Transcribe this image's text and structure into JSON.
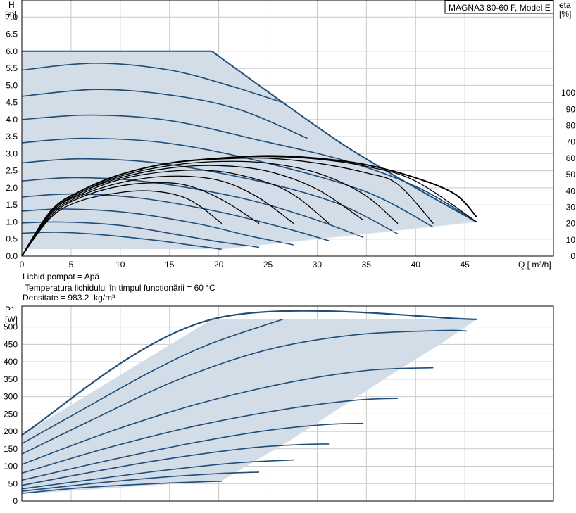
{
  "title": "MAGNA3 80-60 F, Model E",
  "liquid_info": {
    "line1": "Lichid pompat = Apă",
    "line2": " Temperatura lichidului în timpul funcționării = 60 °C",
    "line3": "Densitate = 983.2  kg/m³"
  },
  "colors": {
    "envelope_fill": "#d2dde8",
    "pump_curve": "#1f4e79",
    "envelope_edge": "#1f4e79",
    "efficiency_curve": "#000000"
  },
  "chart_data": [
    {
      "type": "line",
      "name": "head",
      "ylabel_line1": "H",
      "ylabel_line2": "[m]",
      "y2label_line1": "eta",
      "y2label_line2": "[%]",
      "xlabel": "Q [ m³/h]",
      "xlim": [
        0,
        54
      ],
      "ylim": [
        0,
        7.5
      ],
      "y2lim": [
        0,
        157
      ],
      "x_ticks": [
        0,
        5,
        10,
        15,
        20,
        25,
        30,
        35,
        40,
        45
      ],
      "y_ticks": [
        "0.0",
        "0.5",
        "1.0",
        "1.5",
        "2.0",
        "2.5",
        "3.0",
        "3.5",
        "4.0",
        "4.5",
        "5.0",
        "5.5",
        "6.0",
        "6.5",
        "7.0"
      ],
      "y2_ticks": [
        0,
        10,
        20,
        30,
        40,
        50,
        60,
        70,
        80,
        90,
        100
      ],
      "grid": true,
      "envelope": [
        [
          0,
          6.0
        ],
        [
          19.3,
          6.0
        ],
        [
          26.5,
          4.5
        ],
        [
          33,
          3.2
        ],
        [
          40,
          2.0
        ],
        [
          46.2,
          1.0
        ],
        [
          20.3,
          0.2
        ],
        [
          0,
          0.2
        ]
      ],
      "series": [
        {
          "values": [
            [
              0,
              6.0
            ],
            [
              19.3,
              6.0
            ]
          ]
        },
        {
          "values": [
            [
              0,
              5.45
            ],
            [
              7.5,
              5.65
            ],
            [
              15,
              5.45
            ],
            [
              21,
              5.0
            ],
            [
              26.5,
              4.5
            ]
          ]
        },
        {
          "values": [
            [
              0,
              4.68
            ],
            [
              7.5,
              4.88
            ],
            [
              15,
              4.72
            ],
            [
              22,
              4.3
            ],
            [
              29,
              3.45
            ]
          ]
        },
        {
          "values": [
            [
              0,
              4.0
            ],
            [
              7,
              4.13
            ],
            [
              15,
              3.97
            ],
            [
              24,
              3.4
            ],
            [
              33,
              2.78
            ],
            [
              40.3,
              2.0
            ],
            [
              46.2,
              1.0
            ]
          ]
        },
        {
          "values": [
            [
              0,
              3.32
            ],
            [
              6.5,
              3.45
            ],
            [
              15,
              3.3
            ],
            [
              25,
              2.72
            ],
            [
              35,
              1.88
            ],
            [
              41.8,
              0.85
            ]
          ]
        },
        {
          "values": [
            [
              0,
              2.73
            ],
            [
              6,
              2.85
            ],
            [
              14,
              2.72
            ],
            [
              24,
              2.2
            ],
            [
              32,
              1.55
            ],
            [
              38.2,
              0.65
            ]
          ]
        },
        {
          "values": [
            [
              0,
              2.2
            ],
            [
              5.5,
              2.3
            ],
            [
              13,
              2.17
            ],
            [
              22,
              1.72
            ],
            [
              29,
              1.15
            ],
            [
              34.7,
              0.55
            ]
          ]
        },
        {
          "values": [
            [
              0,
              1.73
            ],
            [
              5,
              1.82
            ],
            [
              12,
              1.7
            ],
            [
              20,
              1.3
            ],
            [
              27,
              0.8
            ],
            [
              31.2,
              0.45
            ]
          ]
        },
        {
          "values": [
            [
              0,
              1.32
            ],
            [
              4.5,
              1.38
            ],
            [
              11,
              1.27
            ],
            [
              18,
              0.94
            ],
            [
              23,
              0.6
            ],
            [
              27.6,
              0.33
            ]
          ]
        },
        {
          "values": [
            [
              0,
              0.97
            ],
            [
              4,
              1.0
            ],
            [
              10,
              0.9
            ],
            [
              16,
              0.62
            ],
            [
              20,
              0.42
            ],
            [
              24.1,
              0.26
            ]
          ]
        },
        {
          "values": [
            [
              0,
              0.67
            ],
            [
              3.5,
              0.7
            ],
            [
              8,
              0.63
            ],
            [
              14,
              0.45
            ],
            [
              17,
              0.33
            ],
            [
              20.3,
              0.2
            ]
          ]
        }
      ],
      "efficiency_series": [
        {
          "values": [
            [
              0,
              0
            ],
            [
              3,
              28
            ],
            [
              6,
              40
            ],
            [
              10,
              50
            ],
            [
              15,
              57
            ],
            [
              20,
              60
            ],
            [
              25,
              61.5
            ],
            [
              30,
              60
            ],
            [
              35,
              56
            ],
            [
              40,
              48
            ],
            [
              44,
              38
            ],
            [
              46.2,
              24
            ]
          ]
        },
        {
          "values": [
            [
              0,
              0
            ],
            [
              3,
              28
            ],
            [
              6,
              40
            ],
            [
              10,
              50
            ],
            [
              15,
              57
            ],
            [
              20,
              60
            ],
            [
              25,
              61
            ],
            [
              30,
              59.5
            ],
            [
              35,
              55
            ],
            [
              40,
              46
            ],
            [
              46.2,
              21
            ]
          ]
        },
        {
          "values": [
            [
              0,
              0
            ],
            [
              3,
              28
            ],
            [
              6,
              40
            ],
            [
              10,
              50
            ],
            [
              15,
              57
            ],
            [
              20,
              59.5
            ],
            [
              25,
              60
            ],
            [
              30,
              57
            ],
            [
              35,
              51
            ],
            [
              38.2,
              44
            ],
            [
              41.8,
              20
            ]
          ]
        },
        {
          "values": [
            [
              0,
              0
            ],
            [
              3,
              27
            ],
            [
              6,
              39
            ],
            [
              10,
              49
            ],
            [
              15,
              55.5
            ],
            [
              20,
              58
            ],
            [
              25,
              57
            ],
            [
              30,
              51
            ],
            [
              34.7,
              38
            ],
            [
              38.2,
              20
            ]
          ]
        },
        {
          "values": [
            [
              0,
              0
            ],
            [
              3,
              27
            ],
            [
              6,
              39
            ],
            [
              10,
              48
            ],
            [
              15,
              54
            ],
            [
              20,
              55.5
            ],
            [
              25,
              52
            ],
            [
              30,
              41
            ],
            [
              34.7,
              22
            ]
          ]
        },
        {
          "values": [
            [
              0,
              0
            ],
            [
              3,
              27
            ],
            [
              6,
              38
            ],
            [
              10,
              47
            ],
            [
              15,
              52
            ],
            [
              20,
              52
            ],
            [
              25,
              45
            ],
            [
              28,
              36
            ],
            [
              31.2,
              20
            ]
          ]
        },
        {
          "values": [
            [
              0,
              0
            ],
            [
              3,
              26
            ],
            [
              6,
              37
            ],
            [
              10,
              45
            ],
            [
              15,
              49
            ],
            [
              20,
              46.5
            ],
            [
              24,
              36
            ],
            [
              27.6,
              20
            ]
          ]
        },
        {
          "values": [
            [
              0,
              0
            ],
            [
              3,
              25
            ],
            [
              6,
              36
            ],
            [
              10,
              43
            ],
            [
              14,
              45
            ],
            [
              17,
              43
            ],
            [
              20.5,
              34
            ],
            [
              24.1,
              20
            ]
          ]
        },
        {
          "values": [
            [
              0,
              0
            ],
            [
              3,
              24
            ],
            [
              6,
              34
            ],
            [
              10,
              39
            ],
            [
              13,
              40
            ],
            [
              16,
              37
            ],
            [
              18,
              31
            ],
            [
              20.3,
              20
            ]
          ]
        }
      ]
    },
    {
      "type": "line",
      "name": "power",
      "ylabel_line1": "P1",
      "ylabel_line2": "[W]",
      "xlim": [
        0,
        54
      ],
      "ylim": [
        0,
        560
      ],
      "x_ticks": [
        0,
        5,
        10,
        15,
        20,
        25,
        30,
        35,
        40,
        45
      ],
      "y_ticks": [
        0,
        50,
        100,
        150,
        200,
        250,
        300,
        350,
        400,
        450,
        500
      ],
      "grid": true,
      "envelope": [
        [
          0,
          190
        ],
        [
          19.3,
          522
        ],
        [
          46.2,
          522
        ],
        [
          43,
          460
        ],
        [
          38,
          372
        ],
        [
          33,
          280
        ],
        [
          27,
          170
        ],
        [
          20.3,
          58
        ],
        [
          0,
          20
        ]
      ],
      "series": [
        {
          "values": [
            [
              0,
              190
            ],
            [
              19.3,
              522
            ],
            [
              46.2,
              522
            ]
          ]
        },
        {
          "values": [
            [
              0,
              165
            ],
            [
              6,
              260
            ],
            [
              13,
              370
            ],
            [
              19,
              450
            ],
            [
              26.5,
              522
            ]
          ]
        },
        {
          "values": [
            [
              0,
              135
            ],
            [
              8,
              245
            ],
            [
              16,
              350
            ],
            [
              25,
              435
            ],
            [
              34,
              478
            ],
            [
              43,
              490
            ],
            [
              45.2,
              488
            ]
          ]
        },
        {
          "values": [
            [
              0,
              105
            ],
            [
              9,
              200
            ],
            [
              18,
              280
            ],
            [
              27,
              340
            ],
            [
              35,
              375
            ],
            [
              41.8,
              383
            ]
          ]
        },
        {
          "values": [
            [
              0,
              80
            ],
            [
              9,
              155
            ],
            [
              18,
              218
            ],
            [
              27,
              265
            ],
            [
              34,
              290
            ],
            [
              38.2,
              295
            ]
          ]
        },
        {
          "values": [
            [
              0,
              60
            ],
            [
              9,
              118
            ],
            [
              17,
              165
            ],
            [
              25,
              203
            ],
            [
              31,
              220
            ],
            [
              34.7,
              223
            ]
          ]
        },
        {
          "values": [
            [
              0,
              45
            ],
            [
              8,
              88
            ],
            [
              15,
              122
            ],
            [
              23,
              152
            ],
            [
              28,
              162
            ],
            [
              31.2,
              164
            ]
          ]
        },
        {
          "values": [
            [
              0,
              35
            ],
            [
              8,
              65
            ],
            [
              15,
              90
            ],
            [
              22,
              110
            ],
            [
              27.6,
              118
            ]
          ]
        },
        {
          "values": [
            [
              0,
              28
            ],
            [
              7,
              50
            ],
            [
              14,
              68
            ],
            [
              20,
              79
            ],
            [
              24.1,
              83
            ]
          ]
        },
        {
          "values": [
            [
              0,
              22
            ],
            [
              6,
              38
            ],
            [
              12,
              48
            ],
            [
              17,
              54
            ],
            [
              20.3,
              57
            ]
          ]
        }
      ]
    }
  ]
}
